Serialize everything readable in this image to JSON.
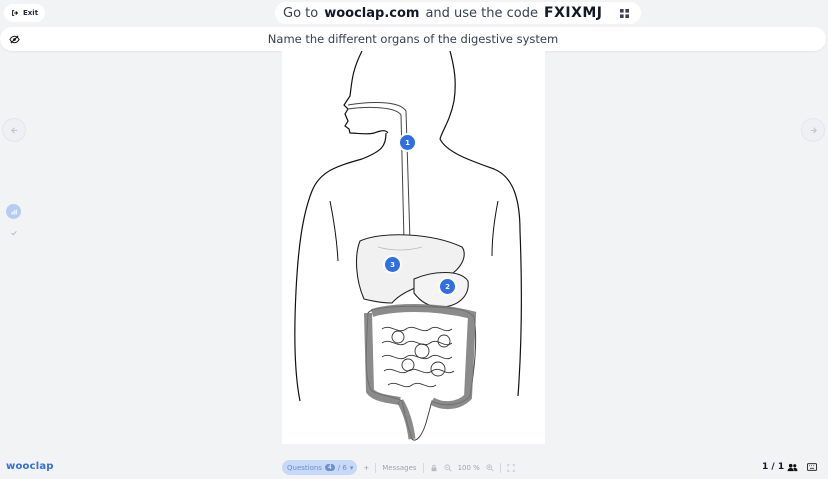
{
  "header": {
    "exit_label": "Exit",
    "join_prefix": "Go to",
    "join_site": "wooclap.com",
    "join_middle": "and use the code",
    "join_code": "FXIXMJ"
  },
  "question": {
    "title": "Name the different organs of the digestive system"
  },
  "markers": [
    {
      "label": "1"
    },
    {
      "label": "2"
    },
    {
      "label": "3"
    }
  ],
  "footer": {
    "brand": "wooclap",
    "questions_label": "Questions",
    "question_current": "4",
    "question_total": "/ 6",
    "messages_label": "Messages",
    "zoom": "100 %",
    "participants": "1 / 1"
  },
  "colors": {
    "accent": "#2f6fe3",
    "background": "#f2f3f5"
  },
  "icons": {
    "exit": "exit-icon",
    "qr": "qr-code-icon",
    "hide": "eye-off-icon",
    "prev": "arrow-left-icon",
    "next": "arrow-right-icon",
    "results": "chart-icon",
    "correct": "check-icon",
    "participants": "users-icon",
    "keyboard": "keyboard-icon"
  }
}
